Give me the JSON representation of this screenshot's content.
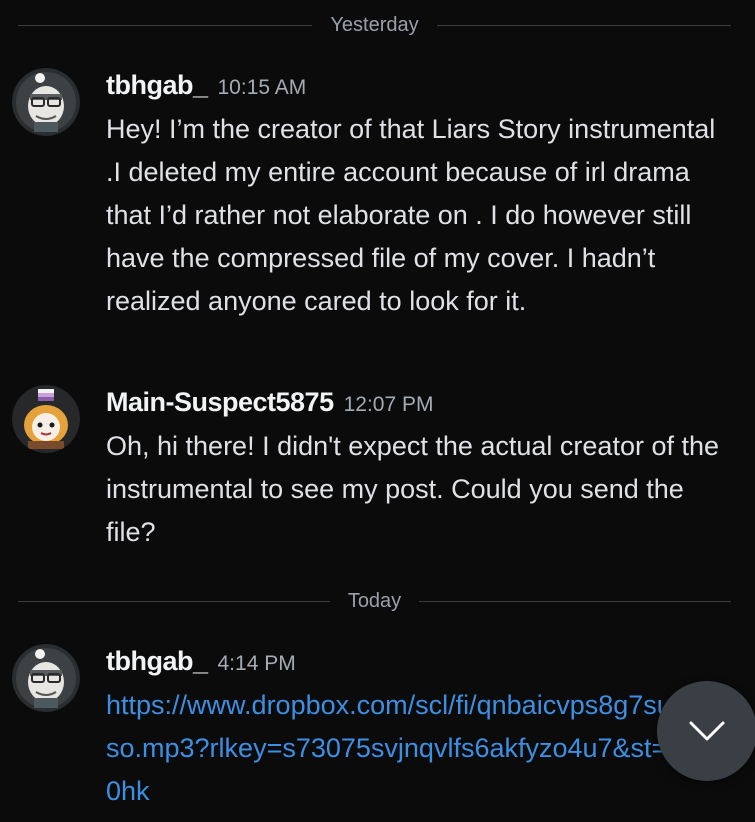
{
  "dividers": {
    "yesterday": "Yesterday",
    "today": "Today"
  },
  "messages": [
    {
      "username": "tbhgab_",
      "time": "10:15 AM",
      "text": "Hey! I’m the creator of that Liars Story instrumental .I deleted my entire account because of irl drama that I’d rather not elaborate on . I do however still have the compressed file of my cover. I hadn’t realized anyone cared to look for it."
    },
    {
      "username": "Main-Suspect5875",
      "time": "12:07 PM",
      "text": "Oh, hi there! I didn't expect the actual creator of the instrumental to see my post. Could you send the file?"
    },
    {
      "username": "tbhgab_",
      "time": "4:14 PM",
      "link": "https://www.dropbox.com/scl/fi/qnbaicvps8g7sui8k/uso.mp3?rlkey=s73075svjnqvlfs6akfyzo4u7&st=mfg80hk"
    }
  ],
  "scroll_button": {
    "icon": "chevron-down-icon"
  },
  "colors": {
    "background": "#0b0b0c",
    "link": "#3d8fe3",
    "username": "#f2f3f5",
    "timestamp": "#a5abb5"
  }
}
